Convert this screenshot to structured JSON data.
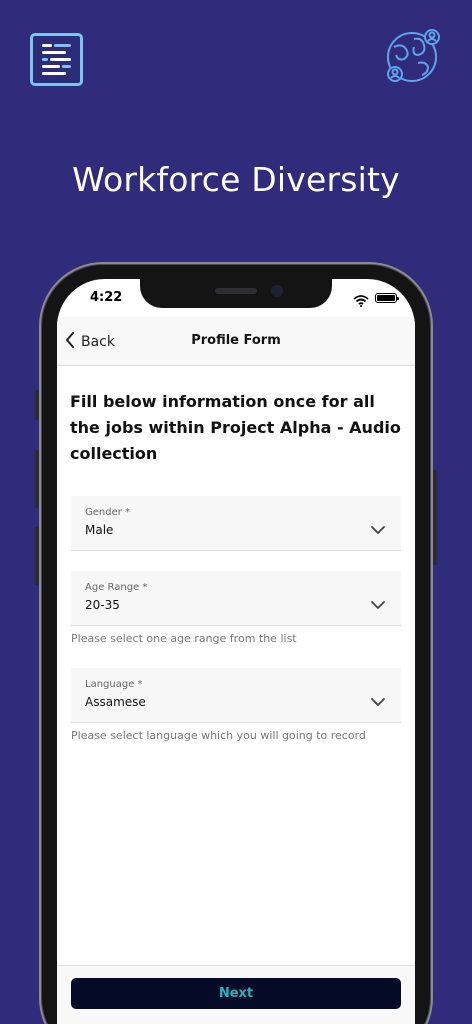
{
  "promo": {
    "title": "Workforce Diversity",
    "logo_icon": "list-lines-icon",
    "globe_icon": "globe-people-icon"
  },
  "status_bar": {
    "time": "4:22",
    "icons": [
      "wifi-icon",
      "battery-icon"
    ]
  },
  "nav": {
    "back_label": "Back",
    "title": "Profile Form"
  },
  "form": {
    "intro": "Fill below information once for all the jobs within Project Alpha - Audio collection",
    "fields": [
      {
        "label": "Gender *",
        "value": "Male",
        "helper": ""
      },
      {
        "label": "Age Range *",
        "value": "20-35",
        "helper": "Please select one age range from the list"
      },
      {
        "label": "Language *",
        "value": "Assamese",
        "helper": "Please select language which you will going to record"
      }
    ]
  },
  "footer": {
    "next_label": "Next"
  },
  "colors": {
    "background": "#312b7b",
    "button": "#050a26",
    "button_text": "#27b3c2",
    "logo_accent": "#7fc4ee"
  }
}
